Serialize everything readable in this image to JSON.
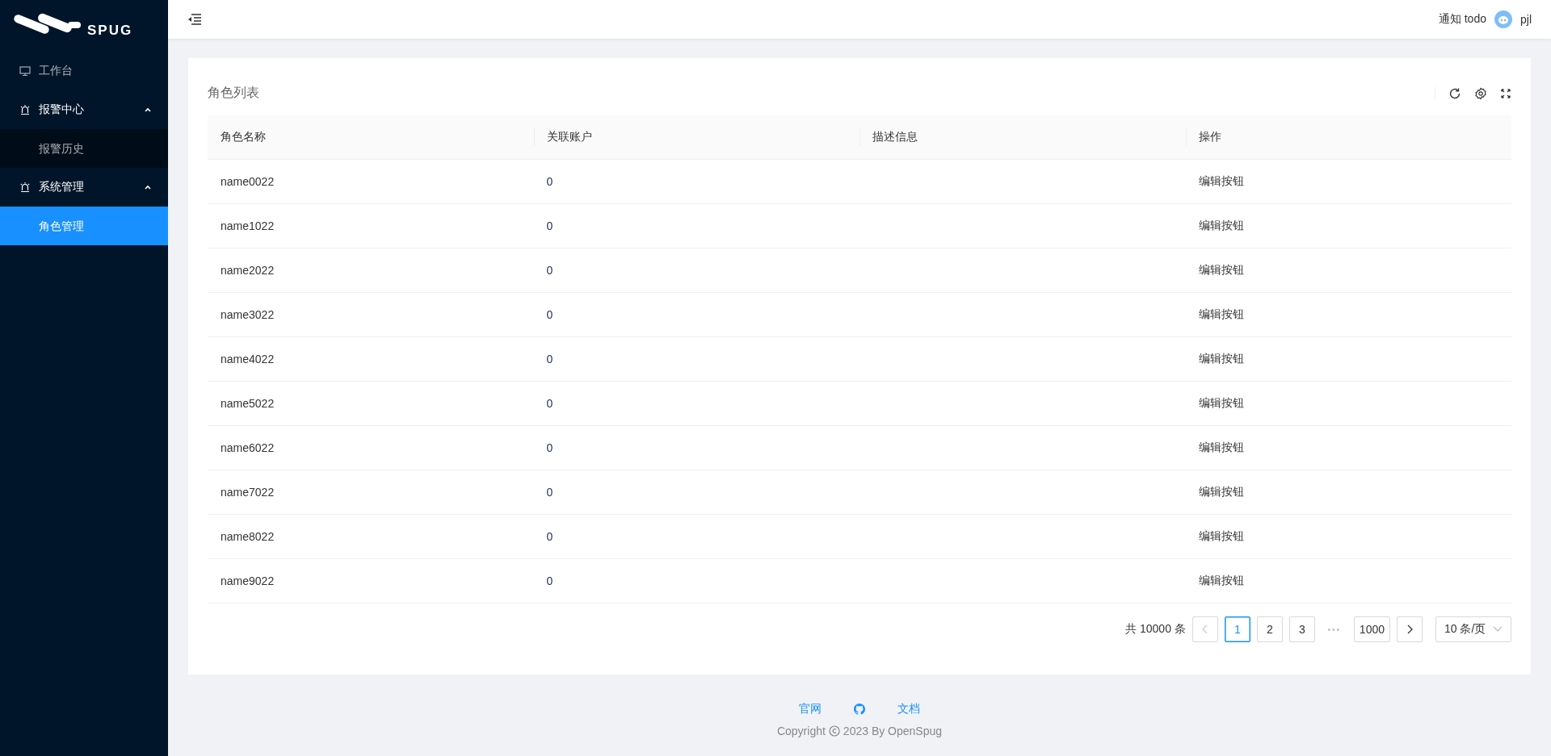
{
  "sidebar": {
    "logo": "SPUG",
    "items": [
      {
        "label": "工作台",
        "selected": false
      },
      {
        "label": "报警中心",
        "expanded": true,
        "children": [
          {
            "label": "报警历史",
            "selected": false
          }
        ]
      },
      {
        "label": "系统管理",
        "expanded": true,
        "children": [
          {
            "label": "角色管理",
            "selected": true
          }
        ]
      }
    ]
  },
  "header": {
    "notice": "通知 todo",
    "user": "pjl"
  },
  "card": {
    "title": "角色列表",
    "table": {
      "columns": [
        "角色名称",
        "关联账户",
        "描述信息",
        "操作"
      ],
      "rows": [
        {
          "name": "name0022",
          "accounts": "0",
          "action": "编辑按钮"
        },
        {
          "name": "name1022",
          "accounts": "0",
          "action": "编辑按钮"
        },
        {
          "name": "name2022",
          "accounts": "0",
          "action": "编辑按钮"
        },
        {
          "name": "name3022",
          "accounts": "0",
          "action": "编辑按钮"
        },
        {
          "name": "name4022",
          "accounts": "0",
          "action": "编辑按钮"
        },
        {
          "name": "name5022",
          "accounts": "0",
          "action": "编辑按钮"
        },
        {
          "name": "name6022",
          "accounts": "0",
          "action": "编辑按钮"
        },
        {
          "name": "name7022",
          "accounts": "0",
          "action": "编辑按钮"
        },
        {
          "name": "name8022",
          "accounts": "0",
          "action": "编辑按钮"
        },
        {
          "name": "name9022",
          "accounts": "0",
          "action": "编辑按钮"
        }
      ]
    },
    "pagination": {
      "total": "共 10000 条",
      "prev_disabled": true,
      "pages": [
        {
          "kind": "page",
          "label": "1",
          "selected": true
        },
        {
          "kind": "page",
          "label": "2",
          "selected": false
        },
        {
          "kind": "page",
          "label": "3",
          "selected": false
        },
        {
          "kind": "ellipsis",
          "label": "•••"
        },
        {
          "kind": "page",
          "label": "1000",
          "selected": false
        }
      ],
      "page_size": "10 条/页"
    }
  },
  "footer": {
    "links": [
      {
        "kind": "text",
        "label": "官网"
      },
      {
        "kind": "github"
      },
      {
        "kind": "text",
        "label": "文档"
      }
    ],
    "copyright": "Copyright",
    "copyright_rest": "2023 By OpenSpug"
  }
}
